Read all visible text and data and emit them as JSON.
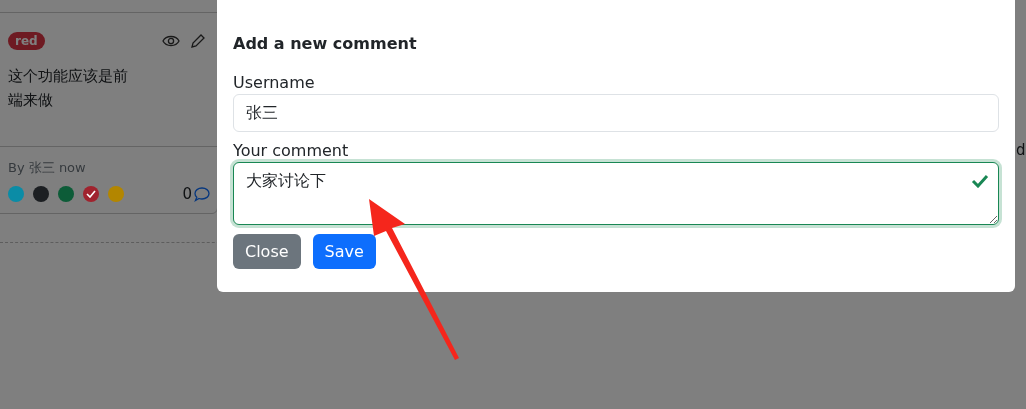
{
  "background_card": {
    "badge": "red",
    "text": "这个功能应该是前端来做",
    "byline": "By 张三 now",
    "colors": [
      {
        "color": "#0b8ca6",
        "selected": false
      },
      {
        "color": "#1c1f22",
        "selected": false
      },
      {
        "color": "#0d5c38",
        "selected": false
      },
      {
        "color": "#a0232e",
        "selected": true
      },
      {
        "color": "#b38600",
        "selected": false
      }
    ],
    "comment_count": "0"
  },
  "background_partial_text": "d",
  "modal": {
    "title": "Add a new comment",
    "username_label": "Username",
    "username_value": "张三",
    "comment_label": "Your comment",
    "comment_value": "大家讨论下",
    "comment_valid": true,
    "buttons": [
      {
        "label": "Close",
        "kind": "secondary"
      },
      {
        "label": "Save",
        "kind": "primary"
      }
    ]
  }
}
